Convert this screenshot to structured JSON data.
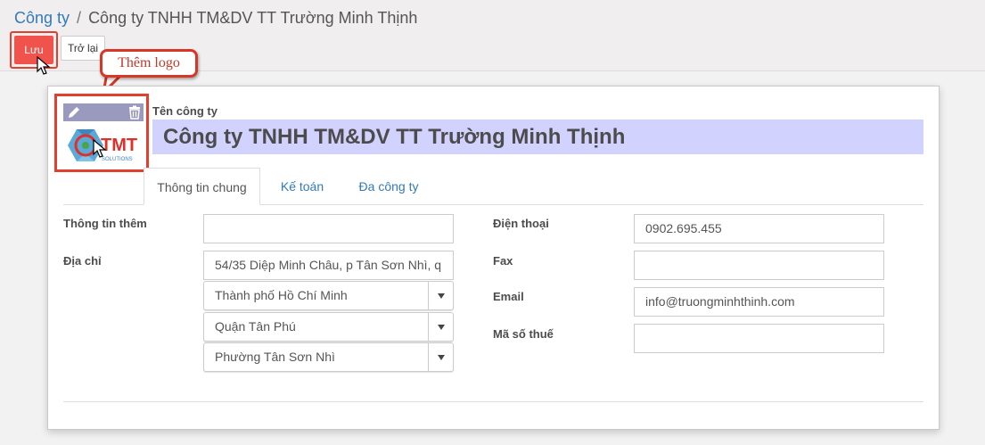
{
  "breadcrumb": {
    "parent": "Công ty",
    "separator": "/",
    "current": "Công ty TNHH TM&DV TT Trường Minh Thịnh"
  },
  "toolbar": {
    "save_label": "Lưu",
    "discard_label": "Trở lại"
  },
  "callout": {
    "text": "Thêm logo"
  },
  "logo": {
    "edit_icon": "pencil-icon",
    "delete_icon": "trash-icon",
    "brand_text": "TMT",
    "brand_subtext": "SOLUTIONS"
  },
  "company": {
    "name_label": "Tên công ty",
    "name_value": "Công ty TNHH TM&DV TT Trường Minh Thịnh"
  },
  "tabs": [
    {
      "label": "Thông tin chung",
      "active": true
    },
    {
      "label": "Kế toán",
      "active": false
    },
    {
      "label": "Đa công ty",
      "active": false
    }
  ],
  "form": {
    "extra_info": {
      "label": "Thông tin thêm",
      "value": ""
    },
    "address": {
      "label": "Địa chỉ",
      "street": "54/35 Diệp Minh Châu, p Tân Sơn Nhì, q",
      "city": "Thành phố Hồ Chí Minh",
      "district": "Quận Tân Phú",
      "ward": "Phường Tân Sơn Nhì"
    },
    "phone": {
      "label": "Điện thoại",
      "value": "0902.695.455"
    },
    "fax": {
      "label": "Fax",
      "value": ""
    },
    "email": {
      "label": "Email",
      "value": "info@truongminhthinh.com"
    },
    "tax_id": {
      "label": "Mã số thuế",
      "value": ""
    }
  },
  "colors": {
    "save_button": "#f0524c",
    "highlight_border": "#e2402f",
    "link": "#337ab7",
    "name_field_bg": "#d2d2ff"
  }
}
